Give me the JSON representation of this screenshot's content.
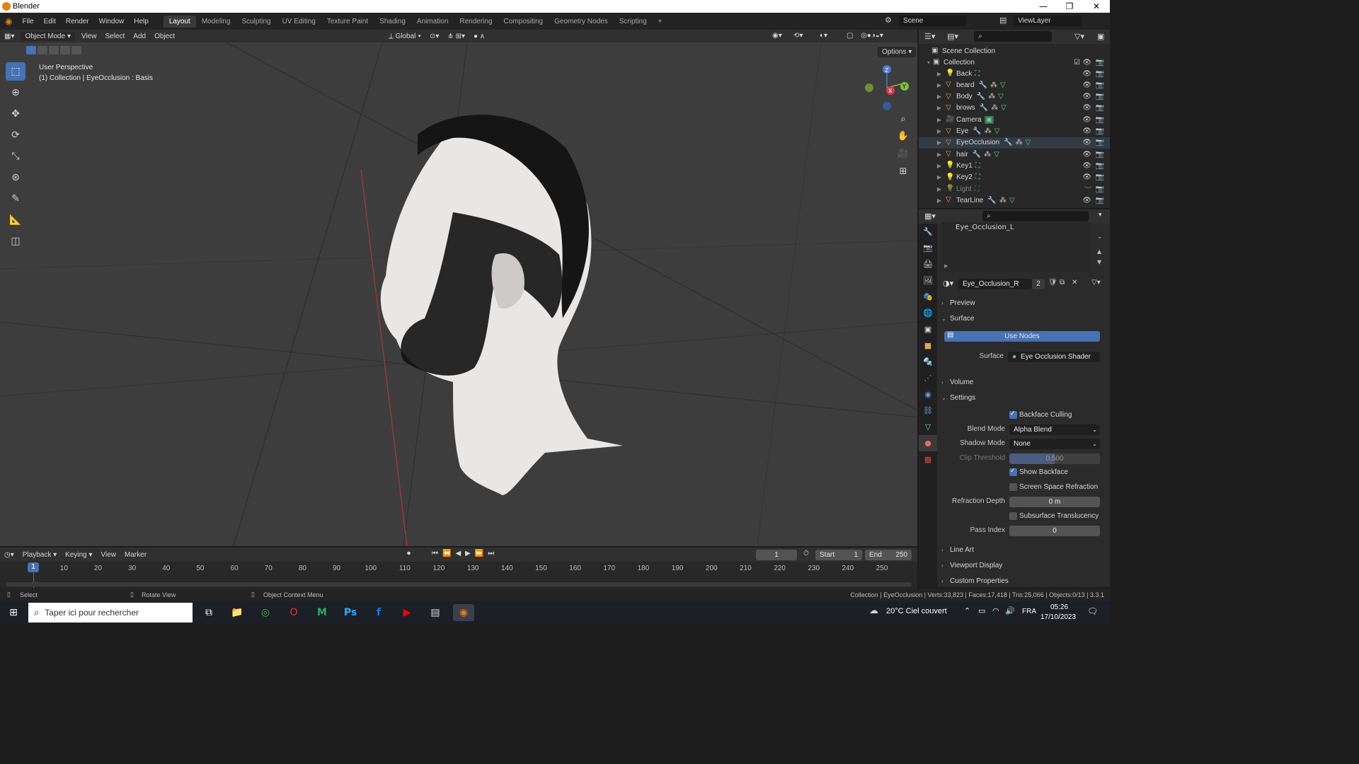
{
  "window": {
    "title": "Blender",
    "minimize": "—",
    "maximize": "❐",
    "close": "✕"
  },
  "menu": [
    "File",
    "Edit",
    "Render",
    "Window",
    "Help"
  ],
  "workspaces": [
    "Layout",
    "Modeling",
    "Sculpting",
    "UV Editing",
    "Texture Paint",
    "Shading",
    "Animation",
    "Rendering",
    "Compositing",
    "Geometry Nodes",
    "Scripting"
  ],
  "workspace_add": "+",
  "scene": {
    "label": "Scene",
    "view_layer": "ViewLayer"
  },
  "viewport_header": {
    "mode": "Object Mode",
    "menus": [
      "View",
      "Select",
      "Add",
      "Object"
    ],
    "orientation": "Global",
    "options": "Options"
  },
  "viewport": {
    "perspective": "User Perspective",
    "info": "(1) Collection | EyeOcclusion : Basis",
    "gizmo": {
      "x": "X",
      "y": "Y",
      "z": "Z"
    }
  },
  "outliner": {
    "scene_collection": "Scene Collection",
    "collection": "Collection",
    "items": [
      {
        "name": "Back",
        "kind": "light",
        "mod": false,
        "data": "constraint"
      },
      {
        "name": "beard",
        "kind": "mesh",
        "mod": true,
        "data": "mesh"
      },
      {
        "name": "Body",
        "kind": "mesh",
        "mod": true,
        "data": "mesh"
      },
      {
        "name": "brows",
        "kind": "mesh",
        "mod": true,
        "data": "mesh"
      },
      {
        "name": "Camera",
        "kind": "camera",
        "mod": false,
        "data": "camera"
      },
      {
        "name": "Eye",
        "kind": "mesh",
        "mod": true,
        "data": "mesh"
      },
      {
        "name": "EyeOcclusion",
        "kind": "mesh",
        "mod": true,
        "data": "mesh"
      },
      {
        "name": "hair",
        "kind": "mesh",
        "mod": true,
        "data": "mesh"
      },
      {
        "name": "Key1",
        "kind": "light",
        "mod": false,
        "data": "constraint"
      },
      {
        "name": "Key2",
        "kind": "light",
        "mod": false,
        "data": "constraint"
      },
      {
        "name": "Light",
        "kind": "light",
        "mod": false,
        "data": "constraint"
      },
      {
        "name": "TearLine",
        "kind": "mesh",
        "mod": true,
        "data": "mesh"
      }
    ]
  },
  "properties": {
    "slot_name": "Eye_Occlusion_L",
    "material": "Eye_Occlusion_R",
    "users": "2",
    "panels": {
      "preview": "Preview",
      "surface": "Surface",
      "use_nodes": "Use Nodes",
      "surface_label": "Surface",
      "surface_value": "Eye Occlusion Shader",
      "volume": "Volume",
      "settings": "Settings",
      "backface_culling": "Backface Culling",
      "blend_mode_label": "Blend Mode",
      "blend_mode": "Alpha Blend",
      "shadow_mode_label": "Shadow Mode",
      "shadow_mode": "None",
      "clip_threshold_label": "Clip Threshold",
      "clip_threshold": "0.500",
      "show_backface": "Show Backface",
      "ssr": "Screen Space Refraction",
      "refraction_depth_label": "Refraction Depth",
      "refraction_depth": "0 m",
      "sss": "Subsurface Translucency",
      "pass_index_label": "Pass Index",
      "pass_index": "0",
      "line_art": "Line Art",
      "viewport_display": "Viewport Display",
      "custom_properties": "Custom Properties"
    }
  },
  "timeline": {
    "menus": [
      "Playback",
      "Keying",
      "View",
      "Marker"
    ],
    "current_frame": "1",
    "start_label": "Start",
    "start": "1",
    "end_label": "End",
    "end": "250",
    "ticks": [
      "1",
      "10",
      "20",
      "30",
      "40",
      "50",
      "60",
      "70",
      "80",
      "90",
      "100",
      "110",
      "120",
      "130",
      "140",
      "150",
      "160",
      "170",
      "180",
      "190",
      "200",
      "210",
      "220",
      "230",
      "240",
      "250"
    ]
  },
  "statusbar": {
    "select": "Select",
    "rotate": "Rotate View",
    "context": "Object Context Menu",
    "stats": "Collection | EyeOcclusion | Verts:33,823 | Faces:17,418 | Tris:25,066 | Objects:0/13 | 3.3.1"
  },
  "taskbar": {
    "search_placeholder": "Taper ici pour rechercher",
    "weather": "20°C  Ciel couvert",
    "lang": "FRA",
    "time": "05:26",
    "date": "17/10/2023"
  }
}
